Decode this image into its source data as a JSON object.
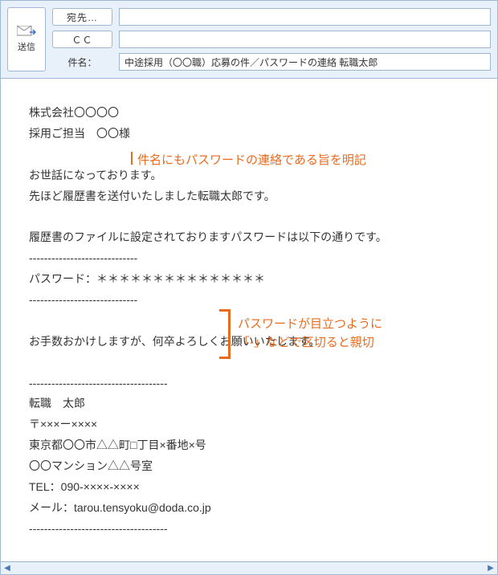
{
  "header": {
    "send_label": "送信",
    "to_button": "宛先…",
    "cc_button": "ＣＣ",
    "subject_label": "件名：",
    "to_value": "",
    "cc_value": "",
    "subject_value": "中途採用（〇〇職）応募の件／パスワードの連絡 転職太郎"
  },
  "body_lines": [
    "株式会社〇〇〇〇",
    "採用ご担当　〇〇様",
    "",
    "お世話になっております。",
    "先ほど履歴書を送付いたしました転職太郎です。",
    "",
    "履歴書のファイルに設定されておりますパスワードは以下の通りです。",
    "-----------------------------",
    "パスワード：＊＊＊＊＊＊＊＊＊＊＊＊＊＊＊",
    "-----------------------------",
    "",
    "お手数おかけしますが、何卒よろしくお願いいたします。",
    "",
    "-------------------------------------",
    "転職　太郎",
    "〒×××ー××××",
    "東京都〇〇市△△町□丁目×番地×号",
    "〇〇マンション△△号室",
    "TEL：090-××××-××××",
    "メール：tarou.tensyoku@doda.co.jp",
    "-------------------------------------"
  ],
  "annotations": {
    "a1": "件名にもパスワードの連絡である旨を明記",
    "a2_l1": "パスワードが目立つように",
    "a2_l2": "「-」などで区切ると親切"
  },
  "scroll": {
    "left_glyph": "◀",
    "right_glyph": "▶"
  }
}
